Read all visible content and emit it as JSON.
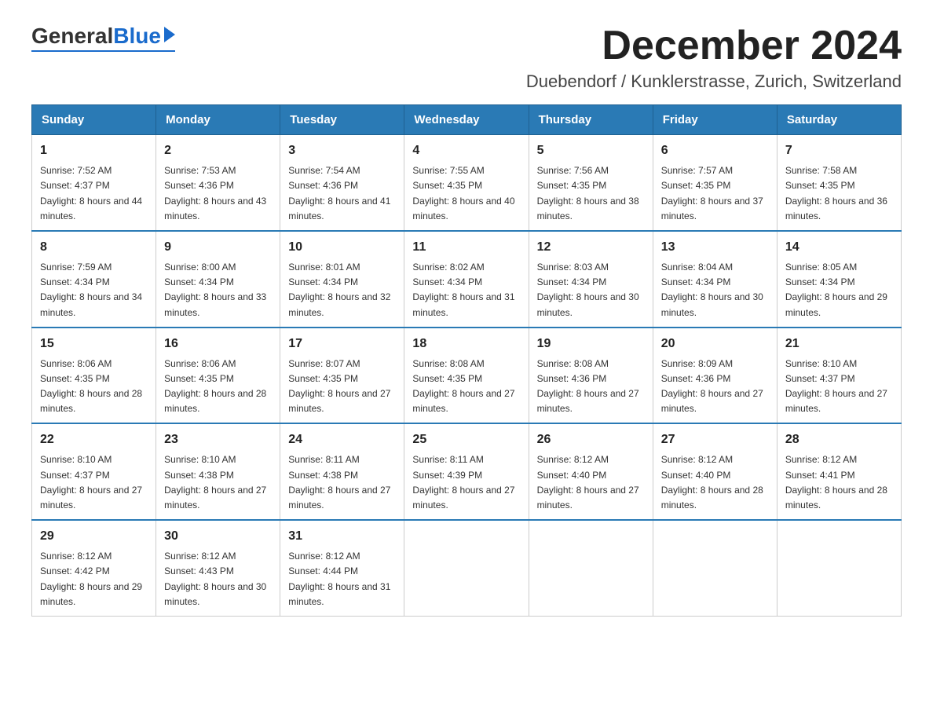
{
  "header": {
    "logo_general": "General",
    "logo_blue": "Blue",
    "title": "December 2024",
    "subtitle": "Duebendorf / Kunklerstrasse, Zurich, Switzerland"
  },
  "days_of_week": [
    "Sunday",
    "Monday",
    "Tuesday",
    "Wednesday",
    "Thursday",
    "Friday",
    "Saturday"
  ],
  "weeks": [
    [
      {
        "day": 1,
        "sunrise": "7:52 AM",
        "sunset": "4:37 PM",
        "daylight": "8 hours and 44 minutes."
      },
      {
        "day": 2,
        "sunrise": "7:53 AM",
        "sunset": "4:36 PM",
        "daylight": "8 hours and 43 minutes."
      },
      {
        "day": 3,
        "sunrise": "7:54 AM",
        "sunset": "4:36 PM",
        "daylight": "8 hours and 41 minutes."
      },
      {
        "day": 4,
        "sunrise": "7:55 AM",
        "sunset": "4:35 PM",
        "daylight": "8 hours and 40 minutes."
      },
      {
        "day": 5,
        "sunrise": "7:56 AM",
        "sunset": "4:35 PM",
        "daylight": "8 hours and 38 minutes."
      },
      {
        "day": 6,
        "sunrise": "7:57 AM",
        "sunset": "4:35 PM",
        "daylight": "8 hours and 37 minutes."
      },
      {
        "day": 7,
        "sunrise": "7:58 AM",
        "sunset": "4:35 PM",
        "daylight": "8 hours and 36 minutes."
      }
    ],
    [
      {
        "day": 8,
        "sunrise": "7:59 AM",
        "sunset": "4:34 PM",
        "daylight": "8 hours and 34 minutes."
      },
      {
        "day": 9,
        "sunrise": "8:00 AM",
        "sunset": "4:34 PM",
        "daylight": "8 hours and 33 minutes."
      },
      {
        "day": 10,
        "sunrise": "8:01 AM",
        "sunset": "4:34 PM",
        "daylight": "8 hours and 32 minutes."
      },
      {
        "day": 11,
        "sunrise": "8:02 AM",
        "sunset": "4:34 PM",
        "daylight": "8 hours and 31 minutes."
      },
      {
        "day": 12,
        "sunrise": "8:03 AM",
        "sunset": "4:34 PM",
        "daylight": "8 hours and 30 minutes."
      },
      {
        "day": 13,
        "sunrise": "8:04 AM",
        "sunset": "4:34 PM",
        "daylight": "8 hours and 30 minutes."
      },
      {
        "day": 14,
        "sunrise": "8:05 AM",
        "sunset": "4:34 PM",
        "daylight": "8 hours and 29 minutes."
      }
    ],
    [
      {
        "day": 15,
        "sunrise": "8:06 AM",
        "sunset": "4:35 PM",
        "daylight": "8 hours and 28 minutes."
      },
      {
        "day": 16,
        "sunrise": "8:06 AM",
        "sunset": "4:35 PM",
        "daylight": "8 hours and 28 minutes."
      },
      {
        "day": 17,
        "sunrise": "8:07 AM",
        "sunset": "4:35 PM",
        "daylight": "8 hours and 27 minutes."
      },
      {
        "day": 18,
        "sunrise": "8:08 AM",
        "sunset": "4:35 PM",
        "daylight": "8 hours and 27 minutes."
      },
      {
        "day": 19,
        "sunrise": "8:08 AM",
        "sunset": "4:36 PM",
        "daylight": "8 hours and 27 minutes."
      },
      {
        "day": 20,
        "sunrise": "8:09 AM",
        "sunset": "4:36 PM",
        "daylight": "8 hours and 27 minutes."
      },
      {
        "day": 21,
        "sunrise": "8:10 AM",
        "sunset": "4:37 PM",
        "daylight": "8 hours and 27 minutes."
      }
    ],
    [
      {
        "day": 22,
        "sunrise": "8:10 AM",
        "sunset": "4:37 PM",
        "daylight": "8 hours and 27 minutes."
      },
      {
        "day": 23,
        "sunrise": "8:10 AM",
        "sunset": "4:38 PM",
        "daylight": "8 hours and 27 minutes."
      },
      {
        "day": 24,
        "sunrise": "8:11 AM",
        "sunset": "4:38 PM",
        "daylight": "8 hours and 27 minutes."
      },
      {
        "day": 25,
        "sunrise": "8:11 AM",
        "sunset": "4:39 PM",
        "daylight": "8 hours and 27 minutes."
      },
      {
        "day": 26,
        "sunrise": "8:12 AM",
        "sunset": "4:40 PM",
        "daylight": "8 hours and 27 minutes."
      },
      {
        "day": 27,
        "sunrise": "8:12 AM",
        "sunset": "4:40 PM",
        "daylight": "8 hours and 28 minutes."
      },
      {
        "day": 28,
        "sunrise": "8:12 AM",
        "sunset": "4:41 PM",
        "daylight": "8 hours and 28 minutes."
      }
    ],
    [
      {
        "day": 29,
        "sunrise": "8:12 AM",
        "sunset": "4:42 PM",
        "daylight": "8 hours and 29 minutes."
      },
      {
        "day": 30,
        "sunrise": "8:12 AM",
        "sunset": "4:43 PM",
        "daylight": "8 hours and 30 minutes."
      },
      {
        "day": 31,
        "sunrise": "8:12 AM",
        "sunset": "4:44 PM",
        "daylight": "8 hours and 31 minutes."
      },
      null,
      null,
      null,
      null
    ]
  ]
}
